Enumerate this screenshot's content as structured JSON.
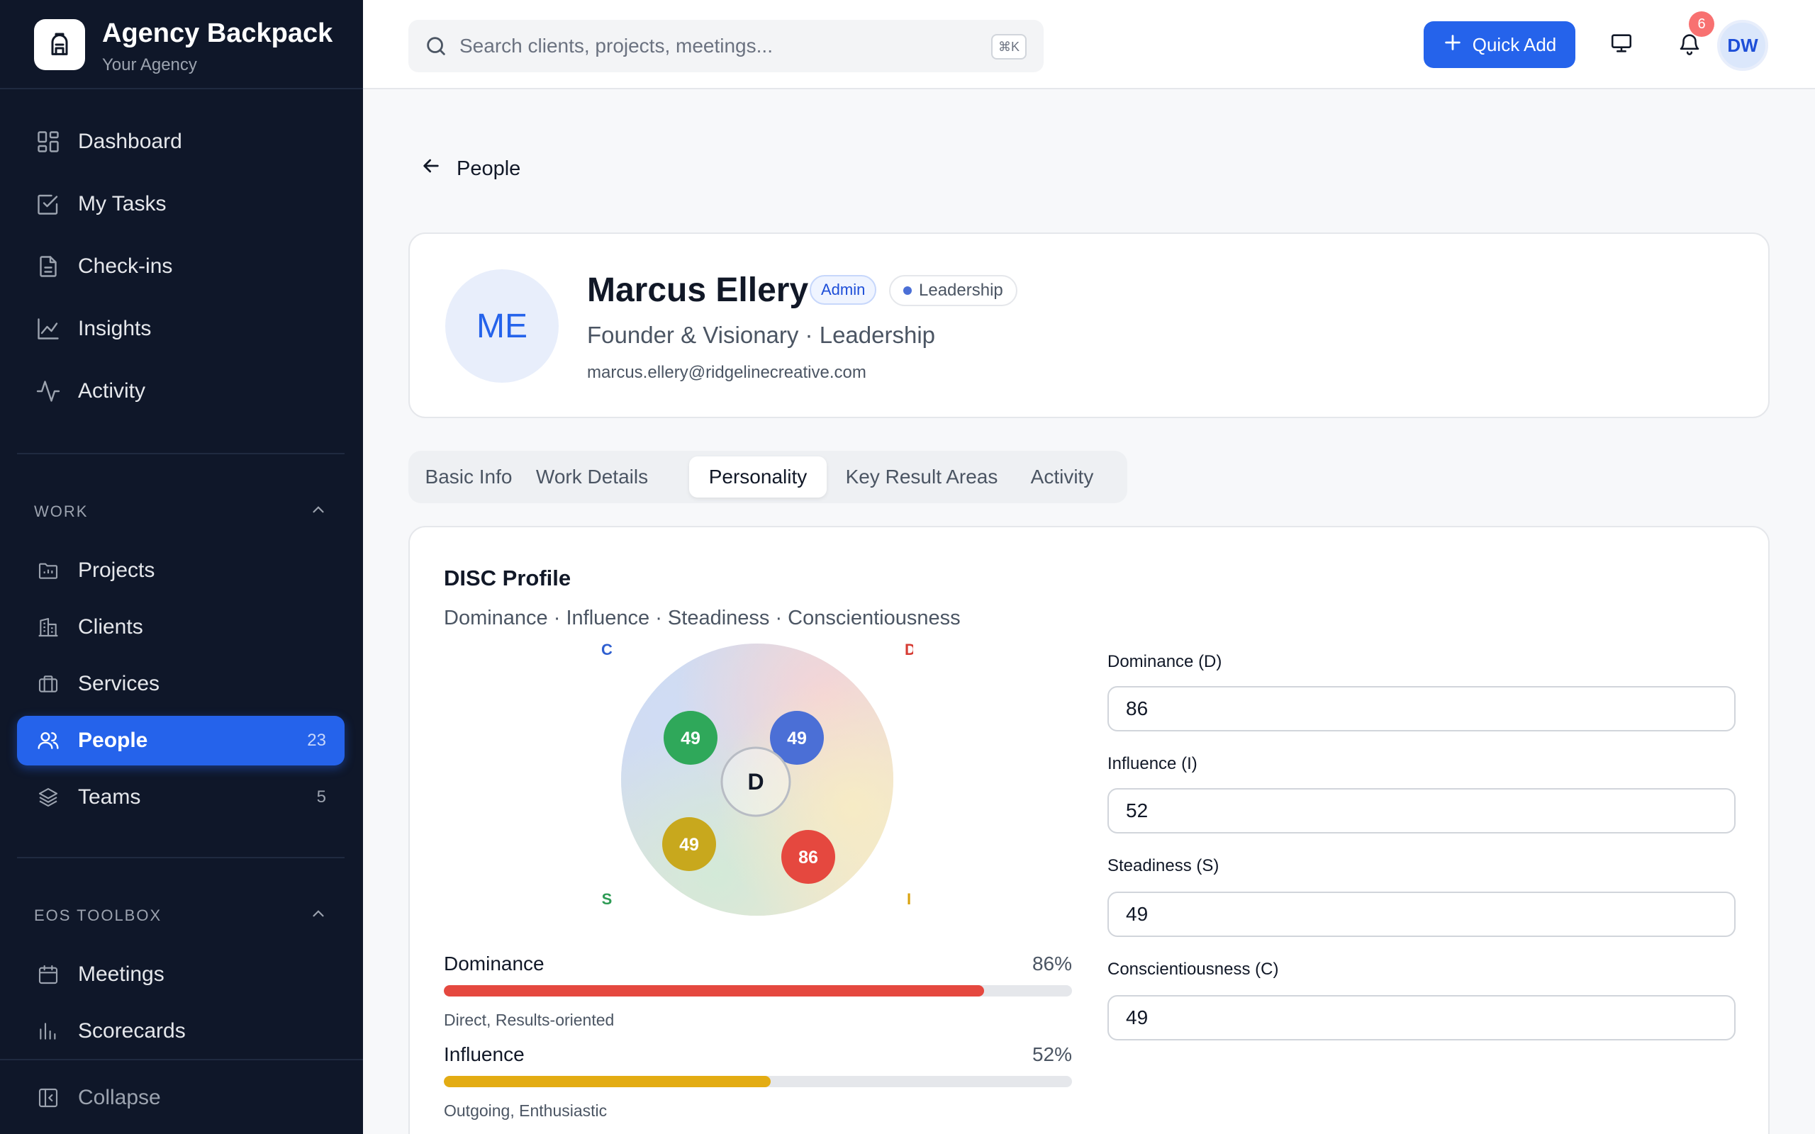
{
  "brand": {
    "title": "Agency Backpack",
    "subtitle": "Your Agency"
  },
  "nav": {
    "main": [
      {
        "label": "Dashboard",
        "icon": "dashboard-icon"
      },
      {
        "label": "My Tasks",
        "icon": "tasks-icon"
      },
      {
        "label": "Check-ins",
        "icon": "checkin-icon"
      },
      {
        "label": "Insights",
        "icon": "insights-icon"
      },
      {
        "label": "Activity",
        "icon": "activity-icon"
      }
    ],
    "work_section": "WORK",
    "work": [
      {
        "label": "Projects",
        "icon": "projects-icon",
        "count": ""
      },
      {
        "label": "Clients",
        "icon": "clients-icon",
        "count": ""
      },
      {
        "label": "Services",
        "icon": "services-icon",
        "count": ""
      },
      {
        "label": "People",
        "icon": "people-icon",
        "count": "23",
        "active": true
      },
      {
        "label": "Teams",
        "icon": "teams-icon",
        "count": "5"
      }
    ],
    "eos_section": "EOS TOOLBOX",
    "eos": [
      {
        "label": "Meetings",
        "icon": "calendar-icon"
      },
      {
        "label": "Scorecards",
        "icon": "scorecards-icon"
      }
    ],
    "collapse_label": "Collapse"
  },
  "topbar": {
    "search_placeholder": "Search clients, projects, meetings...",
    "shortcut": "⌘K",
    "quick_add_label": "Quick Add",
    "notification_count": "6",
    "user_initials": "DW"
  },
  "back_link": "People",
  "profile": {
    "initials": "ME",
    "name": "Marcus Ellery",
    "role_badge": "Admin",
    "team_badge": "Leadership",
    "title_line": "Founder & Visionary · Leadership",
    "email": "marcus.ellery@ridgelinecreative.com"
  },
  "tabs": [
    {
      "label": "Basic Info"
    },
    {
      "label": "Work Details"
    },
    {
      "label": "Personality",
      "active": true
    },
    {
      "label": "Key Result Areas"
    },
    {
      "label": "Activity"
    }
  ],
  "disc": {
    "title": "DISC Profile",
    "subtitle": "Dominance · Influence · Steadiness · Conscientiousness",
    "primary": "D",
    "quadrant_labels": {
      "c": "C",
      "d": "D",
      "s": "S",
      "i": "I"
    },
    "scores": {
      "d": 86,
      "i": 52,
      "s": 49,
      "c": 49
    },
    "bars": [
      {
        "label": "Dominance",
        "percent_text": "86%",
        "value": 86,
        "color": "#e5483f",
        "desc": "Direct, Results-oriented"
      },
      {
        "label": "Influence",
        "percent_text": "52%",
        "value": 52,
        "color": "#e3ac13",
        "desc": "Outgoing, Enthusiastic"
      }
    ],
    "fields": [
      {
        "label": "Dominance (D)",
        "value": "86"
      },
      {
        "label": "Influence (I)",
        "value": "52"
      },
      {
        "label": "Steadiness (S)",
        "value": "49"
      },
      {
        "label": "Conscientiousness (C)",
        "value": "49"
      }
    ]
  },
  "colors": {
    "accent": "#2563eb",
    "sidebar_bg": "#0f1729",
    "dominance": "#e5483f",
    "influence": "#e3ac13",
    "steadiness": "#2fa85a",
    "conscientiousness": "#4b6fd6"
  }
}
